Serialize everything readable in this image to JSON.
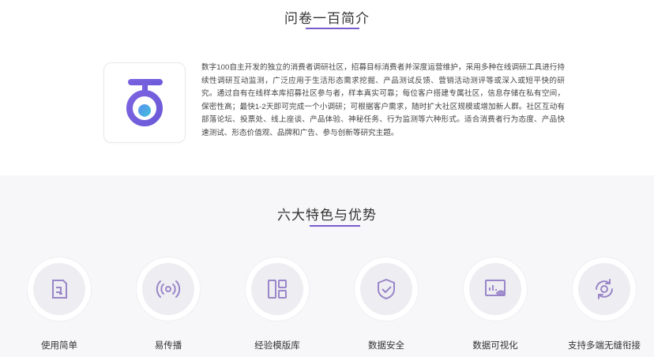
{
  "intro": {
    "title": "问卷一百简介",
    "logo_icon": "wenjuan100-logo-icon",
    "description": "数字100自主开发的独立的消费者调研社区，招募目标消费者并深度运营维护，采用多种在线调研工具进行持续性调研互动监测，广泛应用于生活形态需求挖掘、产品测试反馈、营销活动测评等或深入或短平快的研究。通过自有在线样本库招募社区参与者，样本真实可靠；每位客户搭建专属社区，信息存储在私有空间，保密性高；最快1-2天即可完成一个小调研；可根据客户需求，随时扩大社区规模或增加新人群。社区互动有部落论坛、投票处、线上座谈、产品体验、神秘任务、行为监测等六种形式。适合消费者行为态度、产品快速测试、形态价值观、品牌和广告、参与创新等研究主题。"
  },
  "features": {
    "title": "六大特色与优势",
    "items": [
      {
        "label": "使用简单",
        "icon": "document-icon"
      },
      {
        "label": "易传播",
        "icon": "broadcast-icon"
      },
      {
        "label": "经验模版库",
        "icon": "template-layout-icon"
      },
      {
        "label": "数据安全",
        "icon": "shield-check-icon"
      },
      {
        "label": "数据可视化",
        "icon": "chart-eye-icon"
      },
      {
        "label": "支持多端无缝衔接",
        "icon": "sync-devices-icon"
      }
    ]
  },
  "colors": {
    "accent": "#7a5bd0",
    "icon": "#9a86c8",
    "logo_gradient_start": "#7d63e0",
    "logo_gradient_end": "#4f86f0",
    "features_bg": "#f7f7f9"
  }
}
